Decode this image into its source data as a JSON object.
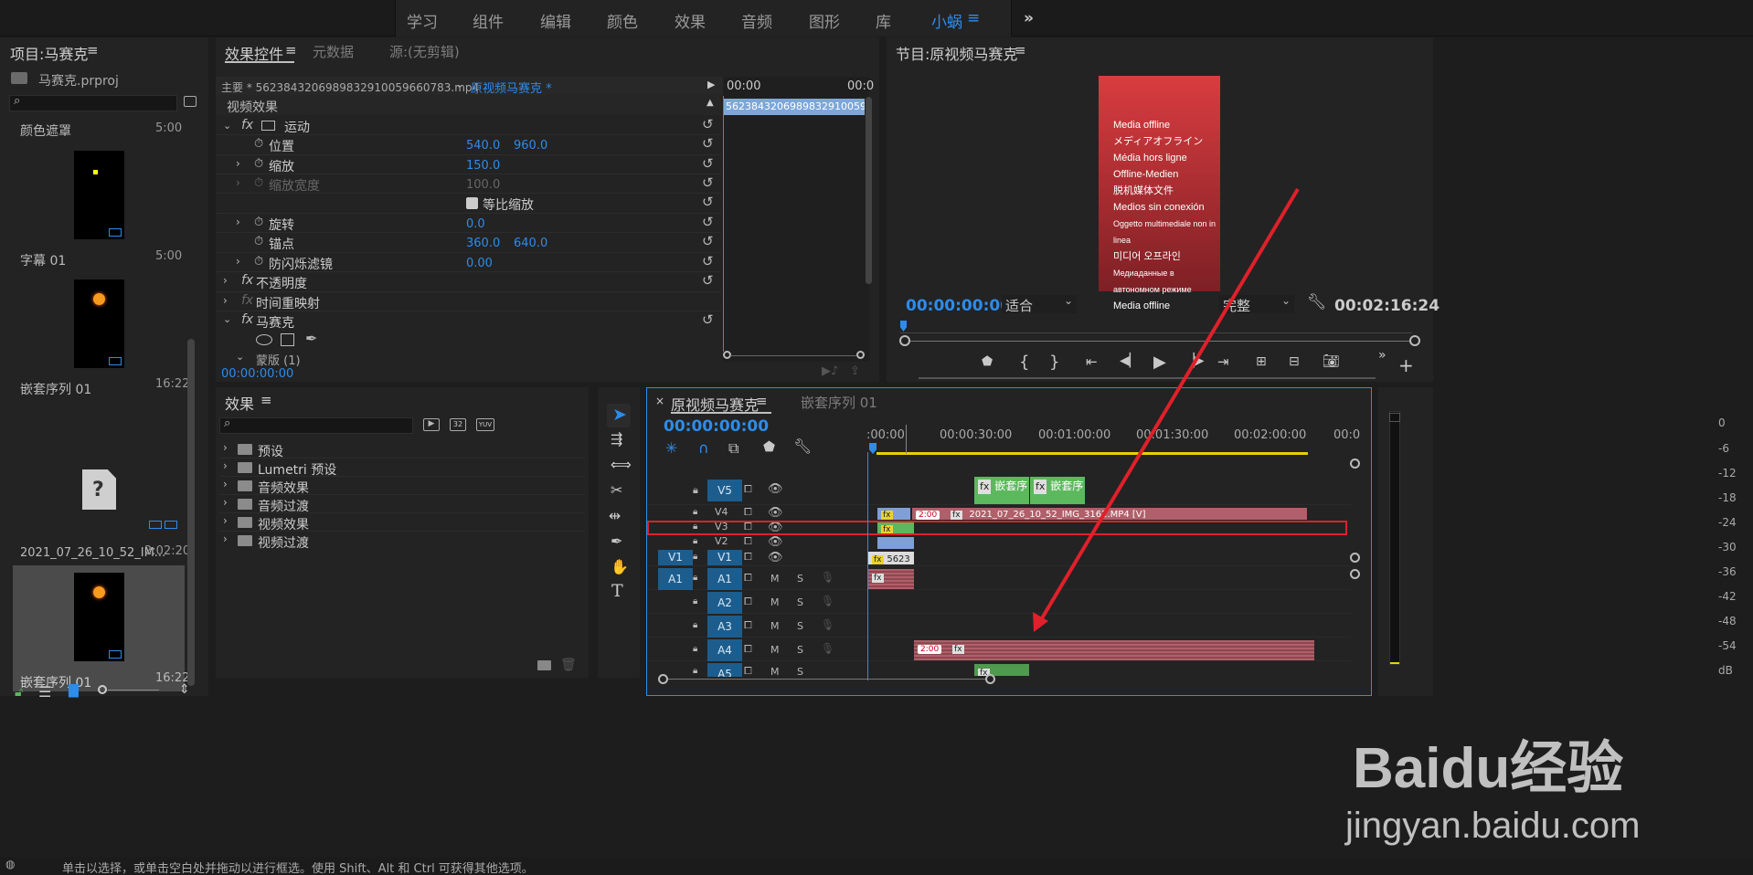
{
  "workspaces": {
    "items": [
      "学习",
      "组件",
      "编辑",
      "颜色",
      "效果",
      "音频",
      "图形",
      "库"
    ],
    "active": "小蜗",
    "more": "»"
  },
  "project": {
    "title": "项目:马赛克",
    "file": "马赛克.prproj",
    "items": [
      {
        "name": "颜色遮罩",
        "duration": "5:00"
      },
      {
        "name": "字幕 01",
        "duration": "5:00"
      },
      {
        "name": "嵌套序列 01",
        "duration": "16:22"
      },
      {
        "name": "2021_07_26_10_52_IM...",
        "duration": "2:02:20"
      },
      {
        "name": "嵌套序列 01",
        "duration": "16:22"
      }
    ],
    "missing_icon": "?"
  },
  "effect_controls": {
    "tabs": [
      "效果控件",
      "元数据",
      "源:(无剪辑)"
    ],
    "master": "主要 * 562384320698983291005966078 3.mp4",
    "master_label": "主要 * 5623843206989832910059660783.mp4",
    "sequence": "原视频马赛克 * 562384320698983291005966...",
    "ruler_start": "00:00",
    "ruler_end": "00:0",
    "clip_strip": "562384320698983291005966",
    "section": "视频效果",
    "rows": [
      {
        "name": "运动",
        "kind": "fx"
      },
      {
        "name": "位置",
        "v1": "540.0",
        "v2": "960.0"
      },
      {
        "name": "缩放",
        "v1": "150.0"
      },
      {
        "name": "缩放宽度",
        "v1": "100.0"
      },
      {
        "name": "等比缩放"
      },
      {
        "name": "旋转",
        "v1": "0.0"
      },
      {
        "name": "锚点",
        "v1": "360.0",
        "v2": "640.0"
      },
      {
        "name": "防闪烁滤镜",
        "v1": "0.00"
      },
      {
        "name": "不透明度",
        "kind": "fx"
      },
      {
        "name": "时间重映射",
        "kind": "fx"
      },
      {
        "name": "马赛克",
        "kind": "fx"
      },
      {
        "name": "蒙版 (1)"
      }
    ],
    "timecode": "00:00:00:00"
  },
  "program": {
    "title": "节目:原视频马赛克",
    "timecode": "00:00:00:00",
    "fit": "适合",
    "quality": "完整",
    "duration": "00:02:16:24",
    "offline_lines": [
      "Media offline",
      "メディアオフライン",
      "Média hors ligne",
      "Offline-Medien",
      "脱机媒体文件",
      "Medios sin conexión",
      "Oggetto multimediale non in linea",
      "미디어 오프라인",
      "Медиаданные в автономном режиме",
      "Media offline"
    ]
  },
  "effects": {
    "title": "效果",
    "items": [
      "预设",
      "Lumetri 预设",
      "音频效果",
      "音频过渡",
      "视频效果",
      "视频过渡"
    ],
    "btn_32": "32",
    "btn_yuv": "YUV"
  },
  "timeline": {
    "close": "×",
    "tabs": [
      "原视频马赛克",
      "嵌套序列 01"
    ],
    "timecode": "00:00:00:00",
    "ruler": [
      ":00:00",
      "00:00:30:00",
      "00:01:00:00",
      "00:01:30:00",
      "00:02:00:00",
      "00:0"
    ],
    "video_tracks": [
      "V5",
      "V4",
      "V3",
      "V2",
      "V1"
    ],
    "audio_tracks": [
      "A1",
      "A2",
      "A3",
      "A4",
      "A5"
    ],
    "src_v1": "V1",
    "src_a1": "A1",
    "m_label": "M",
    "s_label": "S",
    "clips": {
      "nest_a": "嵌套序",
      "nest_b": "嵌套序",
      "main_clip": "2021_07_26_10_52_IMG_3162.MP4 [V]",
      "speed": "2:00",
      "speed_a4": "2:00",
      "v1_clip": "5623",
      "fx": "fx"
    }
  },
  "meter": {
    "labels": [
      "0",
      "-6",
      "-12",
      "-18",
      "-24",
      "-30",
      "-36",
      "-42",
      "-48",
      "-54",
      "dB"
    ]
  },
  "status_bar": {
    "text": "单击以选择，或单击空白处并拖动以进行框选。使用 Shift、Alt 和 Ctrl 可获得其他选项。"
  },
  "watermark": {
    "brand": "Baidu经验",
    "url": "jingyan.baidu.com"
  },
  "colors": {
    "accent": "#2d8ceb",
    "annotation": "#e0202a",
    "clip_green": "#5cb85c",
    "clip_pink": "#b0606a",
    "clip_blue": "#7f9fd6"
  }
}
